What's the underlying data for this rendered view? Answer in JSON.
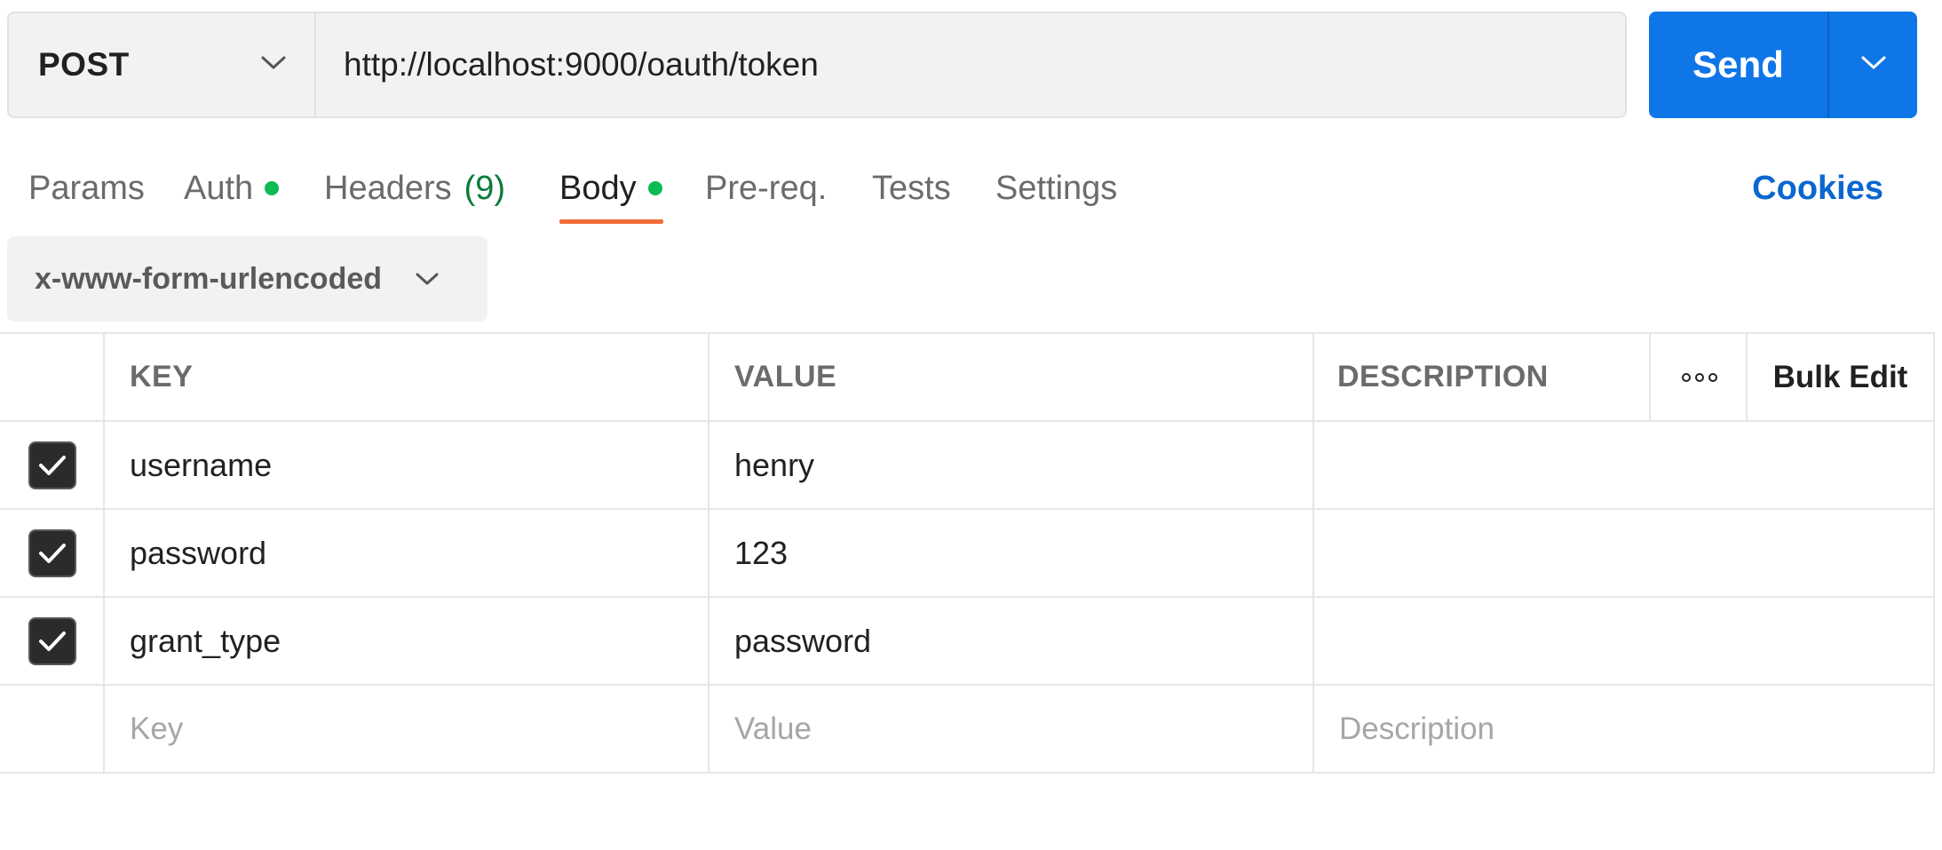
{
  "request": {
    "method": "POST",
    "url": "http://localhost:9000/oauth/token",
    "send_label": "Send"
  },
  "tabs": [
    {
      "label": "Params",
      "active": false
    },
    {
      "label": "Auth",
      "active": false,
      "indicator": true
    },
    {
      "label": "Headers",
      "count": "(9)",
      "active": false
    },
    {
      "label": "Body",
      "active": true,
      "indicator": true
    },
    {
      "label": "Pre-req.",
      "active": false
    },
    {
      "label": "Tests",
      "active": false
    },
    {
      "label": "Settings",
      "active": false
    }
  ],
  "cookies_label": "Cookies",
  "body": {
    "type": "x-www-form-urlencoded"
  },
  "table": {
    "headers": {
      "key": "KEY",
      "value": "VALUE",
      "description": "DESCRIPTION",
      "bulk_edit": "Bulk Edit"
    },
    "rows": [
      {
        "checked": true,
        "key": "username",
        "value": "henry",
        "description": ""
      },
      {
        "checked": true,
        "key": "password",
        "value": "123",
        "description": ""
      },
      {
        "checked": true,
        "key": "grant_type",
        "value": "password",
        "description": ""
      }
    ],
    "placeholders": {
      "key": "Key",
      "value": "Value",
      "description": "Description"
    }
  },
  "icons": {
    "method_dropdown": "chevron-down-icon",
    "send_dropdown": "chevron-down-icon",
    "body_type_dropdown": "chevron-down-icon",
    "more": "more-horizontal-icon",
    "checkbox": "checkmark-icon"
  },
  "colors": {
    "send": "#0f76e7",
    "indicator": "#0cbb52",
    "active_tab_underline": "#f26b3a",
    "cookies": "#0b67d0",
    "headers_count": "#0b7a3a"
  }
}
